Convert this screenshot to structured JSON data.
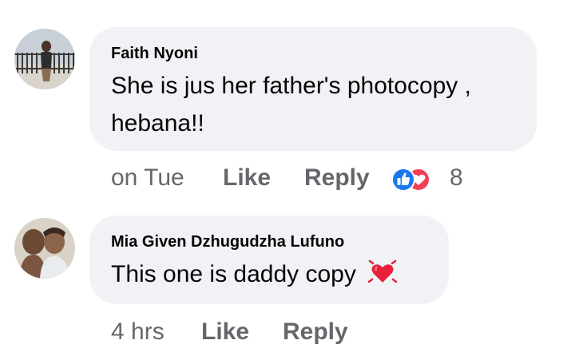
{
  "comments": [
    {
      "author": "Faith Nyoni",
      "text_line1": "She is jus her father's photocopy ,",
      "text_line2": "hebana!!",
      "time": "on Tue",
      "like_label": "Like",
      "reply_label": "Reply",
      "reaction_count": "8",
      "reactions": [
        "like-icon",
        "love-icon"
      ]
    },
    {
      "author": "Mia Given Dzhugudzha Lufuno",
      "text": "This one is daddy copy",
      "emoji": "beating-heart-emoji",
      "time": "4 hrs",
      "like_label": "Like",
      "reply_label": "Reply"
    }
  ],
  "colors": {
    "bubble": "#f0f2f5",
    "text": "#050505",
    "meta": "#65676b",
    "like_blue": "#1877f2",
    "love_red": "#f33e58"
  }
}
